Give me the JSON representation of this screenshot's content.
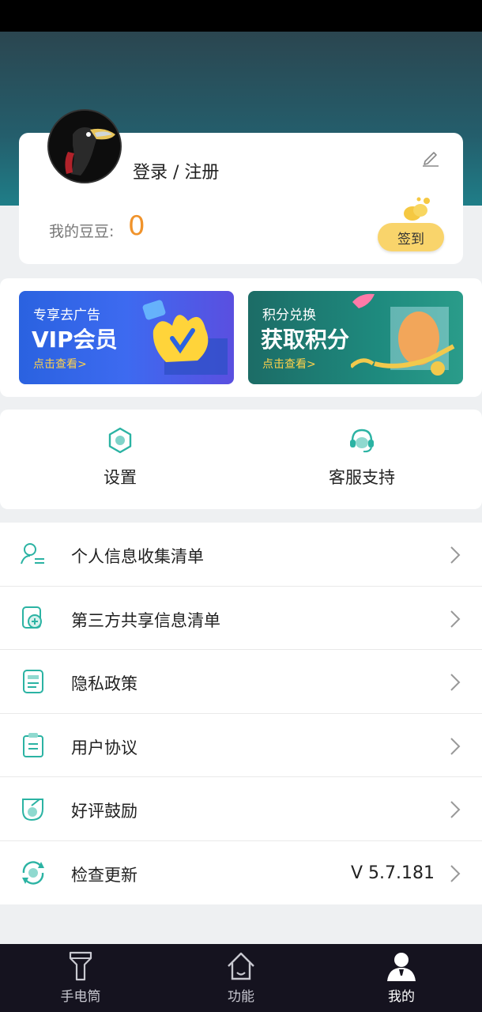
{
  "profile": {
    "login_label": "登录 / 注册",
    "beans_label": "我的豆豆:",
    "beans_value": "0",
    "sign_in_label": "签到"
  },
  "promos": [
    {
      "subtitle": "专享去广告",
      "title": "VIP会员",
      "cta": "点击查看>"
    },
    {
      "subtitle": "积分兑换",
      "title": "获取积分",
      "cta": "点击查看>"
    }
  ],
  "quick_actions": [
    {
      "label": "设置",
      "icon": "settings-hexagon-icon"
    },
    {
      "label": "客服支持",
      "icon": "headset-icon"
    }
  ],
  "menu": [
    {
      "label": "个人信息收集清单",
      "icon": "person-list-icon",
      "value": ""
    },
    {
      "label": "第三方共享信息清单",
      "icon": "share-doc-icon",
      "value": ""
    },
    {
      "label": "隐私政策",
      "icon": "document-icon",
      "value": ""
    },
    {
      "label": "用户协议",
      "icon": "agreement-icon",
      "value": ""
    },
    {
      "label": "好评鼓励",
      "icon": "rating-icon",
      "value": ""
    },
    {
      "label": "检查更新",
      "icon": "refresh-icon",
      "value": "V 5.7.181"
    }
  ],
  "tabs": [
    {
      "label": "手电筒",
      "icon": "flashlight-icon",
      "active": false
    },
    {
      "label": "功能",
      "icon": "home-icon",
      "active": false
    },
    {
      "label": "我的",
      "icon": "user-icon",
      "active": true
    }
  ],
  "colors": {
    "accent_teal": "#2bb3a3",
    "beans_orange": "#f0932b",
    "sign_button": "#f9d46b",
    "tabbar_bg": "#15131f"
  }
}
